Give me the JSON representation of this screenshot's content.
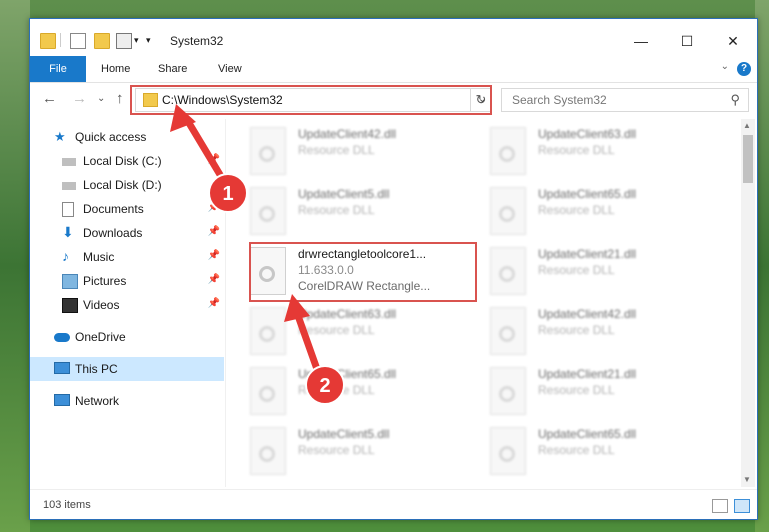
{
  "window": {
    "title": "System32",
    "status": "103 items"
  },
  "ribbon": {
    "tabs": [
      "File",
      "Home",
      "Share",
      "View"
    ],
    "help": "?"
  },
  "address": {
    "path": "C:\\Windows\\System32",
    "search_placeholder": "Search System32"
  },
  "sidebar": {
    "items": [
      {
        "label": "Quick access",
        "icon": "star-icon",
        "pinned": false
      },
      {
        "label": "Local Disk (C:)",
        "icon": "drive-icon",
        "pinned": true
      },
      {
        "label": "Local Disk (D:)",
        "icon": "drive-icon",
        "pinned": false
      },
      {
        "label": "Documents",
        "icon": "document-icon",
        "pinned": true
      },
      {
        "label": "Downloads",
        "icon": "download-icon",
        "pinned": true
      },
      {
        "label": "Music",
        "icon": "music-icon",
        "pinned": true
      },
      {
        "label": "Pictures",
        "icon": "pictures-icon",
        "pinned": true
      },
      {
        "label": "Videos",
        "icon": "videos-icon",
        "pinned": true
      },
      {
        "label": "OneDrive",
        "icon": "cloud-icon",
        "pinned": false
      },
      {
        "label": "This PC",
        "icon": "computer-icon",
        "pinned": false
      },
      {
        "label": "Network",
        "icon": "network-icon",
        "pinned": false
      }
    ]
  },
  "files": [
    {
      "name": "UpdateClient42.dll",
      "desc": "Resource DLL"
    },
    {
      "name": "UpdateClient63.dll",
      "desc": "Resource DLL"
    },
    {
      "name": "UpdateClient5.dll",
      "desc": "Resource DLL"
    },
    {
      "name": "UpdateClient65.dll",
      "desc": "Resource DLL"
    },
    {
      "name": "drwrectangletoolcore1...",
      "desc": "11.633.0.0",
      "extra": "CorelDRAW Rectangle..."
    },
    {
      "name": "UpdateClient21.dll",
      "desc": "Resource DLL"
    },
    {
      "name": "UpdateClient63.dll",
      "desc": "Resource DLL"
    },
    {
      "name": "UpdateClient42.dll",
      "desc": "Resource DLL"
    },
    {
      "name": "UpdateClient65.dll",
      "desc": "Resource DLL"
    },
    {
      "name": "UpdateClient21.dll",
      "desc": "Resource DLL"
    },
    {
      "name": "UpdateClient5.dll",
      "desc": "Resource DLL"
    },
    {
      "name": "UpdateClient65.dll",
      "desc": "Resource DLL"
    }
  ],
  "annotations": {
    "step1": "1",
    "step2": "2"
  },
  "colors": {
    "accent": "#1979ca",
    "highlight": "#d9534f"
  }
}
